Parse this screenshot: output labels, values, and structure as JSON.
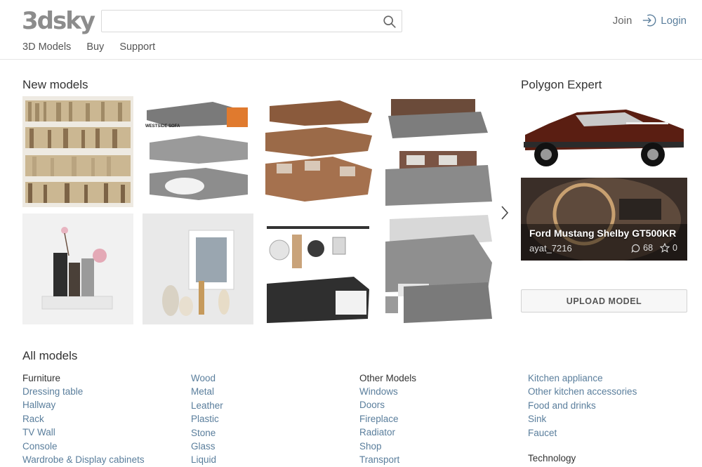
{
  "header": {
    "logo": "3dsky",
    "search": {
      "value": "",
      "placeholder": ""
    },
    "nav": [
      "3D Models",
      "Buy",
      "Support"
    ],
    "join_label": "Join",
    "login_label": "Login"
  },
  "new_models": {
    "title": "New models"
  },
  "expert": {
    "title": "Polygon Expert",
    "model_name": "Ford Mustang Shelby GT500KR",
    "author": "ayat_7216",
    "comments": "68",
    "rating": "0",
    "upload_label": "UPLOAD MODEL"
  },
  "all_models": {
    "title": "All models",
    "col1": {
      "head": "Furniture",
      "links": [
        "Dressing table",
        "Hallway",
        "Rack",
        "TV Wall",
        "Console",
        "Wardrobe & Display cabinets"
      ]
    },
    "col2": {
      "links": [
        "Wood",
        "Metal",
        "Leather",
        "Plastic",
        "Stone",
        "Glass",
        "Liquid"
      ]
    },
    "col3": {
      "head": "Other Models",
      "links": [
        "Windows",
        "Doors",
        "Fireplace",
        "Radiator",
        "Shop",
        "Transport"
      ]
    },
    "col4": {
      "links": [
        "Kitchen appliance",
        "Other kitchen accessories",
        "Food and drinks",
        "Sink",
        "Faucet"
      ],
      "head2": "Technology"
    }
  },
  "thumb_labels": {
    "sofa_label": "WESTSIDE SOFA"
  },
  "colors": {
    "link": "#5a7e9c",
    "logo": "#8c8c8c",
    "expert_card_bg": "#3b3b3b"
  }
}
